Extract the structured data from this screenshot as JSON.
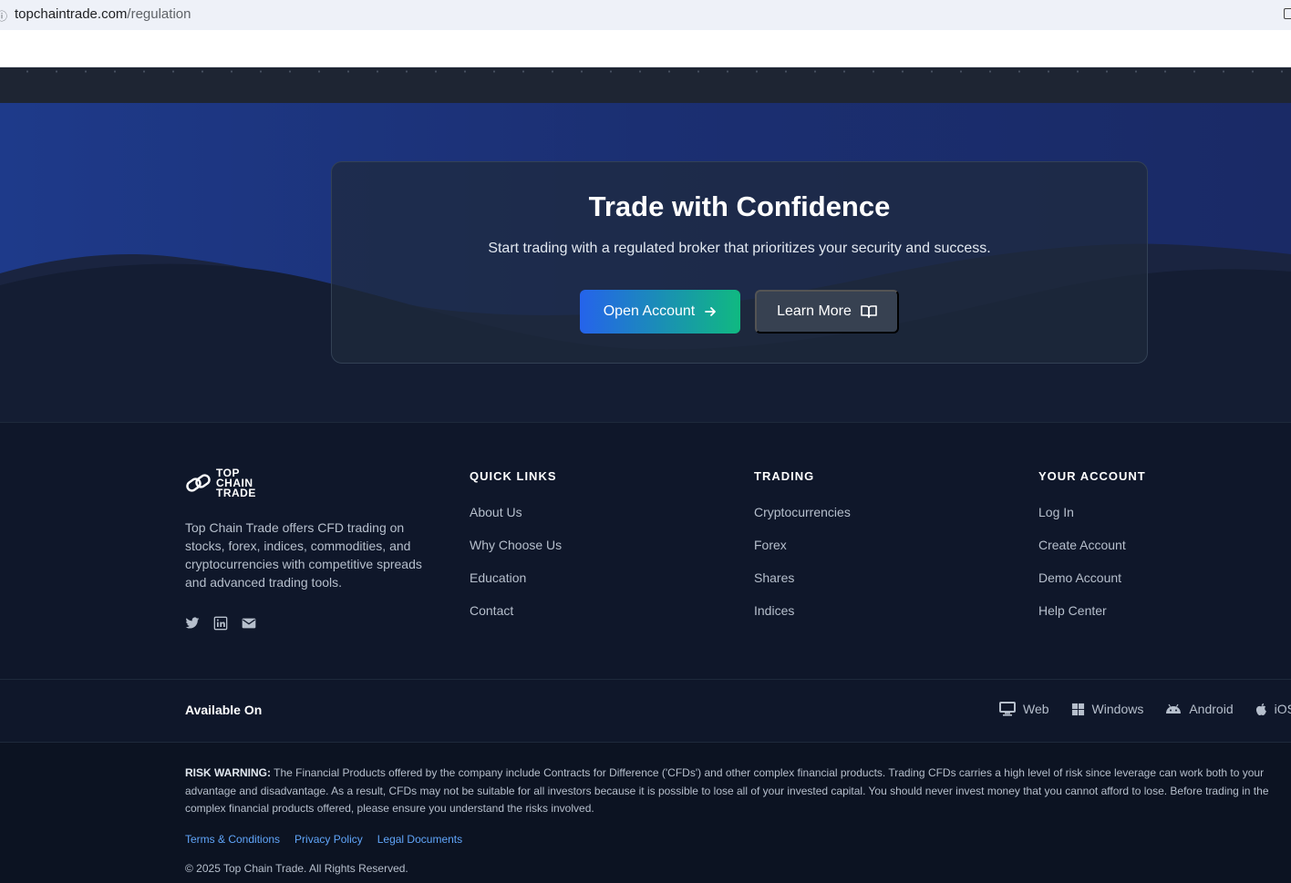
{
  "browser": {
    "url_domain": "topchaintrade.com",
    "url_path": "/regulation"
  },
  "cta": {
    "title": "Trade with Confidence",
    "subtitle": "Start trading with a regulated broker that prioritizes your security and success.",
    "open_account_label": "Open Account",
    "learn_more_label": "Learn More"
  },
  "brand": {
    "logo_lines": [
      "TOP",
      "CHAIN",
      "TRADE"
    ],
    "description": "Top Chain Trade offers CFD trading on stocks, forex, indices, commodities, and cryptocurrencies with competitive spreads and advanced trading tools."
  },
  "footer": {
    "quick_links": {
      "heading": "QUICK LINKS",
      "items": [
        "About Us",
        "Why Choose Us",
        "Education",
        "Contact"
      ]
    },
    "trading": {
      "heading": "TRADING",
      "items": [
        "Cryptocurrencies",
        "Forex",
        "Shares",
        "Indices"
      ]
    },
    "account": {
      "heading": "YOUR ACCOUNT",
      "items": [
        "Log In",
        "Create Account",
        "Demo Account",
        "Help Center"
      ]
    },
    "available_on": "Available On",
    "platforms": [
      "Web",
      "Windows",
      "Android",
      "iOS"
    ],
    "risk_label": "RISK WARNING:",
    "risk_text": " The Financial Products offered by the company include Contracts for Difference ('CFDs') and other complex financial products. Trading CFDs carries a high level of risk since leverage can work both to your advantage and disadvantage. As a result, CFDs may not be suitable for all investors because it is possible to lose all of your invested capital. You should never invest money that you cannot afford to lose. Before trading in the complex financial products offered, please ensure you understand the risks involved.",
    "legal_links": [
      "Terms & Conditions",
      "Privacy Policy",
      "Legal Documents"
    ],
    "copyright": "© 2025 Top Chain Trade. All Rights Reserved."
  },
  "colors": {
    "background": "#0f172a",
    "card": "#1e293b",
    "accent_blue": "#2563eb",
    "accent_green": "#10b981",
    "link_blue": "#60a5fa"
  }
}
